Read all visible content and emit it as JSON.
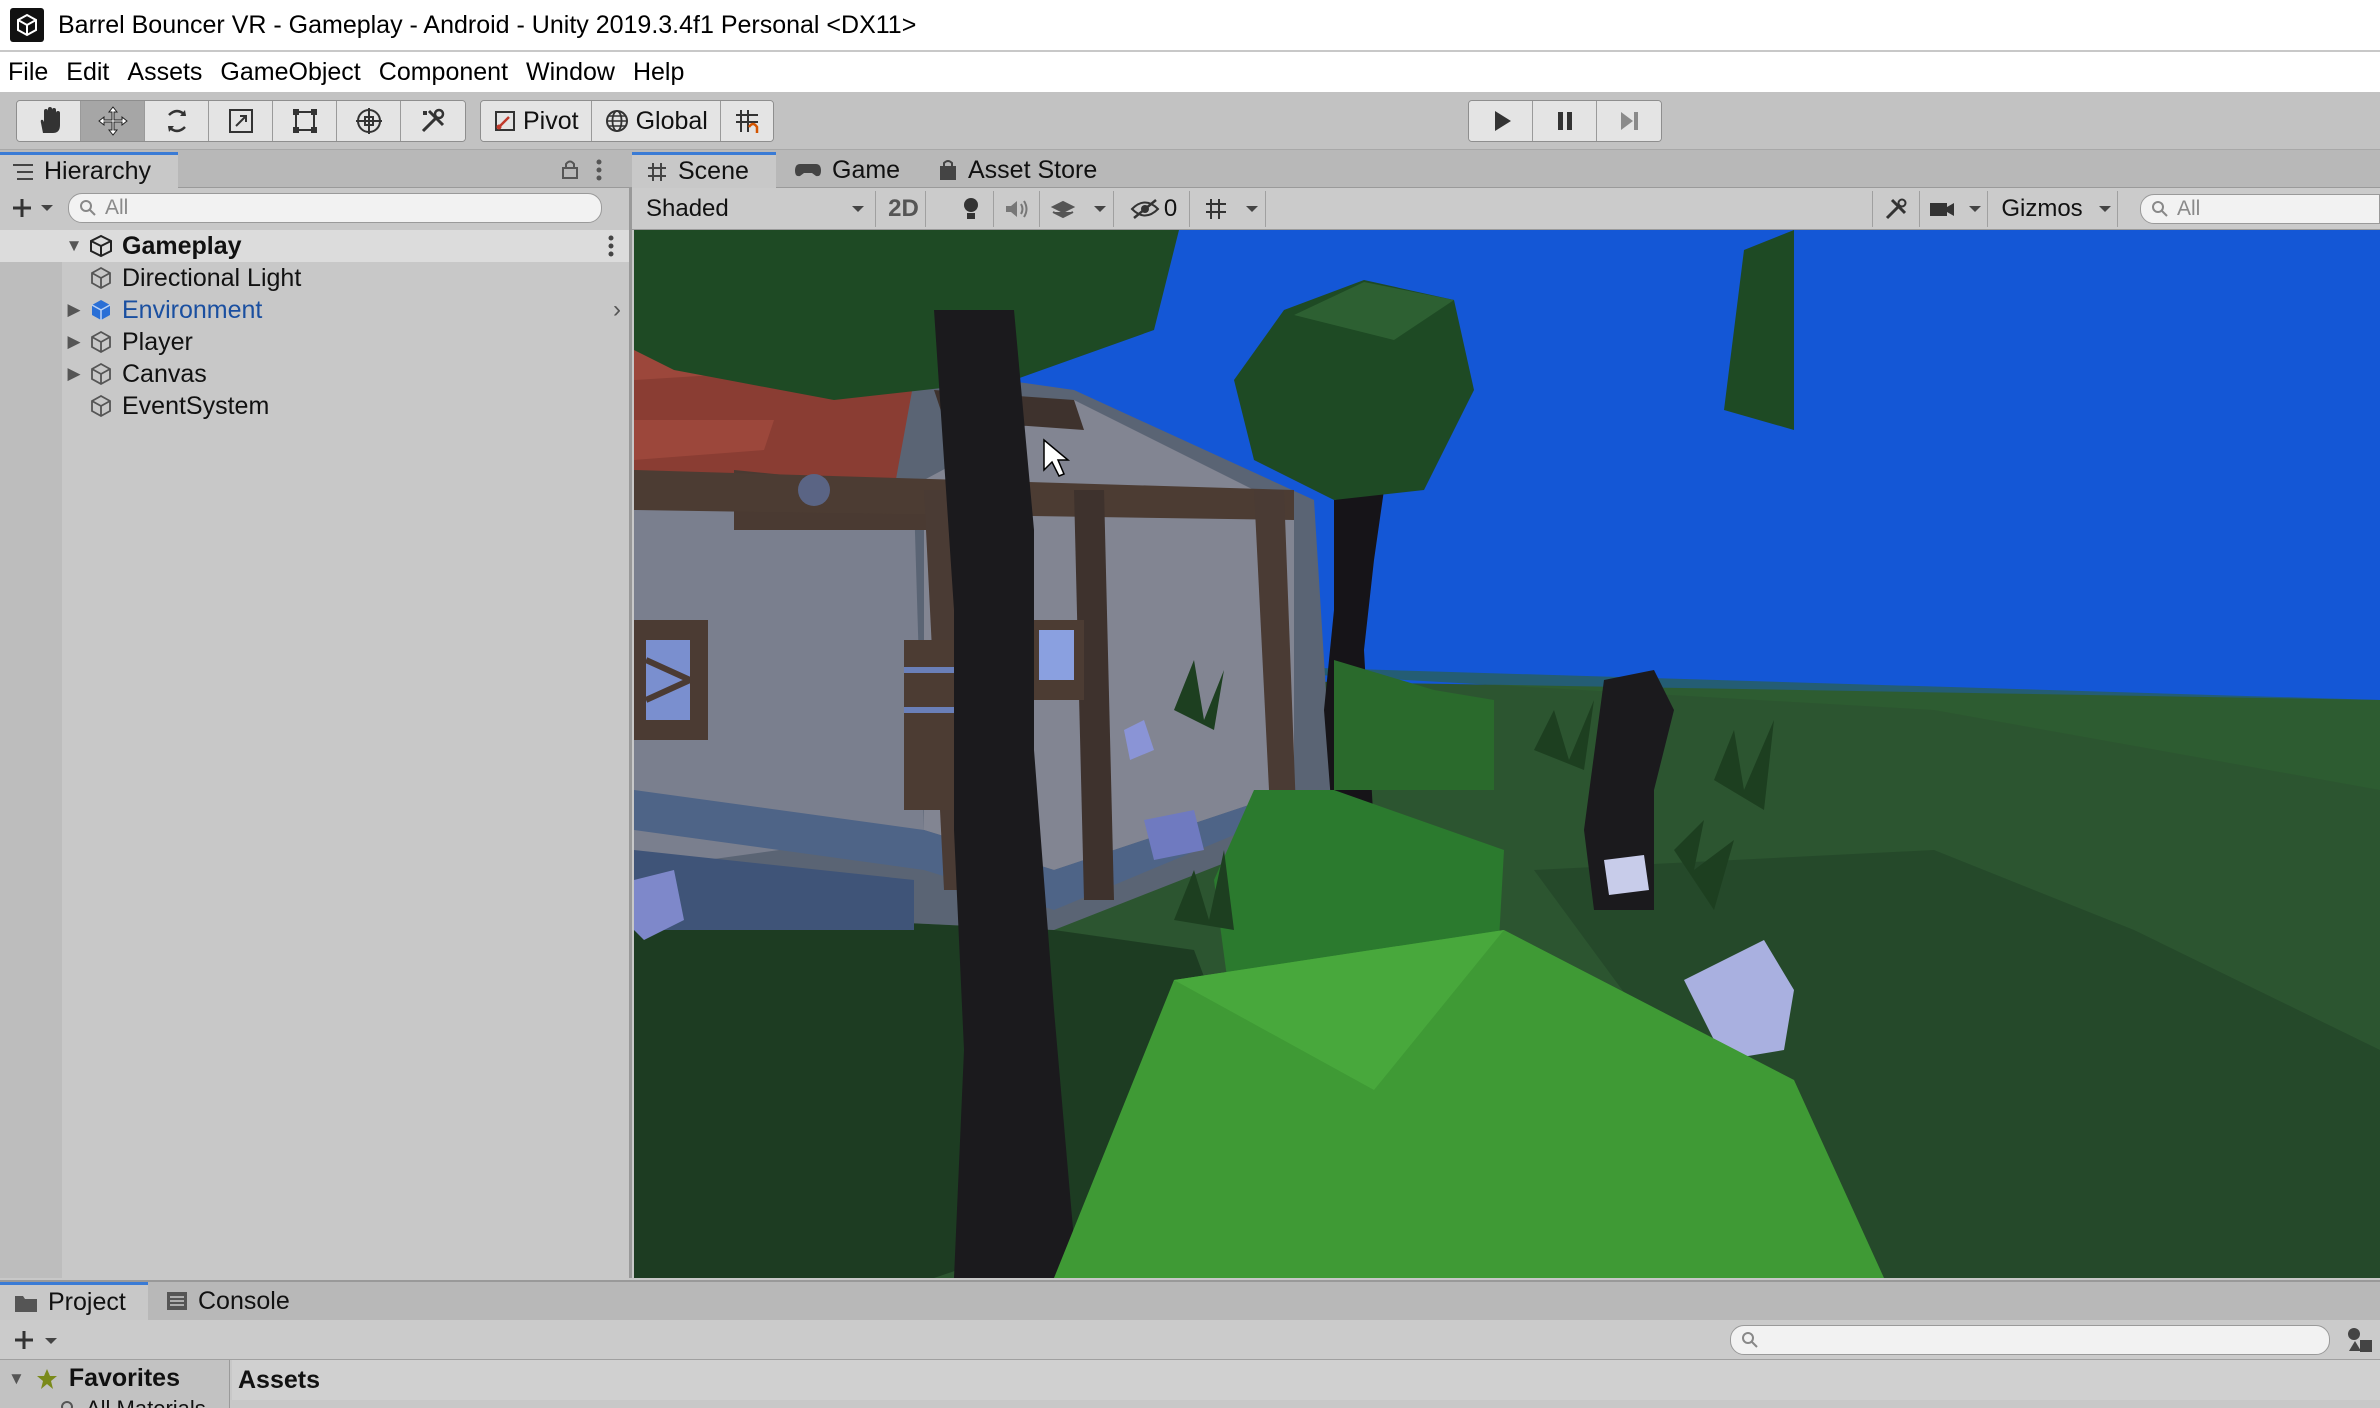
{
  "window": {
    "title": "Barrel Bouncer VR - Gameplay - Android - Unity 2019.3.4f1 Personal <DX11>"
  },
  "menu": [
    "File",
    "Edit",
    "Assets",
    "GameObject",
    "Component",
    "Window",
    "Help"
  ],
  "toolbar": {
    "pivot_label": "Pivot",
    "global_label": "Global"
  },
  "hierarchy": {
    "tab_label": "Hierarchy",
    "search_placeholder": "All",
    "scene_name": "Gameplay",
    "items": [
      {
        "label": "Directional Light",
        "has_children": false,
        "color": "#111111"
      },
      {
        "label": "Environment",
        "has_children": true,
        "color": "#1a4fa0"
      },
      {
        "label": "Player",
        "has_children": true,
        "color": "#111111"
      },
      {
        "label": "Canvas",
        "has_children": true,
        "color": "#111111"
      },
      {
        "label": "EventSystem",
        "has_children": false,
        "color": "#111111"
      }
    ]
  },
  "scene": {
    "tabs": [
      "Scene",
      "Game",
      "Asset Store"
    ],
    "shading_mode": "Shaded",
    "mode_2d_label": "2D",
    "hidden_count": "0",
    "gizmos_label": "Gizmos",
    "search_placeholder": "All"
  },
  "project": {
    "tabs": [
      "Project",
      "Console"
    ],
    "favorites_label": "Favorites",
    "favorites_item": "All Materials",
    "assets_label": "Assets"
  },
  "colors": {
    "accent_blue": "#3a7bd5",
    "sky": "#1457d6",
    "grass_dark": "#22482a",
    "grass_light": "#3f9a35"
  }
}
